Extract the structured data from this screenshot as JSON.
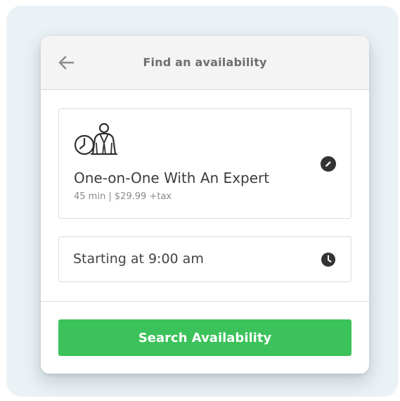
{
  "header": {
    "title": "Find an availability",
    "back_icon": "arrow-left-icon"
  },
  "service": {
    "icon": "expert-clock-icon",
    "name": "One-on-One With An Expert",
    "meta": "45 min | $29.99 +tax",
    "edit_icon": "pencil-icon"
  },
  "time": {
    "label": "Starting at 9:00 am",
    "icon": "clock-icon"
  },
  "actions": {
    "search_label": "Search Availability"
  },
  "colors": {
    "accent": "#3cc25a",
    "header_bg": "#f4f4f4",
    "backdrop": "#ebf2f6",
    "icon_dark": "#333333"
  }
}
